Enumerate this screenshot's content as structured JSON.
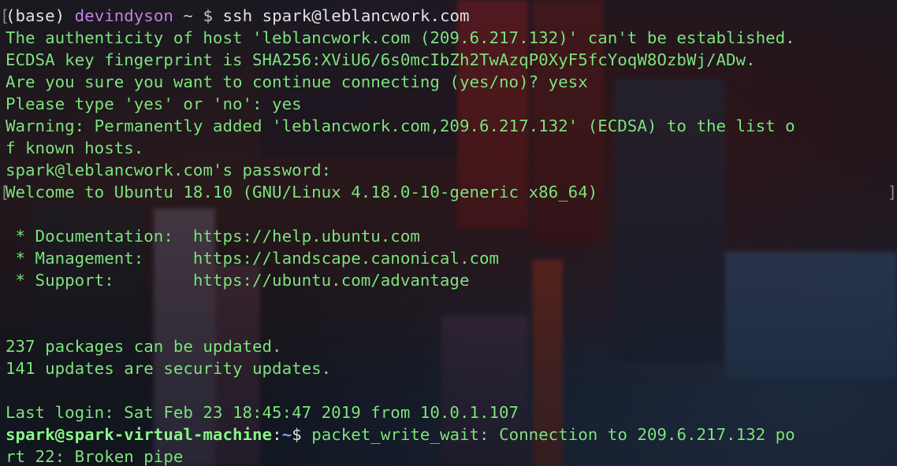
{
  "terminal": {
    "prompt": {
      "env": "(base)",
      "user": "devindyson",
      "path_symbol": "~",
      "dollar": "$",
      "command": "ssh spark@leblancwork.com"
    },
    "lines": [
      "The authenticity of host 'leblancwork.com (209.6.217.132)' can't be established.",
      "ECDSA key fingerprint is SHA256:XViU6/6s0mcIbZh2TwAzqP0XyF5fcYoqW8OzbWj/ADw.",
      "Are you sure you want to continue connecting (yes/no)? yesx",
      "Please type 'yes' or 'no': yes",
      "Warning: Permanently added 'leblancwork.com,209.6.217.132' (ECDSA) to the list o",
      "f known hosts.",
      "spark@leblancwork.com's password:",
      "Welcome to Ubuntu 18.10 (GNU/Linux 4.18.0-10-generic x86_64)",
      "",
      " * Documentation:  https://help.ubuntu.com",
      " * Management:     https://landscape.canonical.com",
      " * Support:        https://ubuntu.com/advantage",
      "",
      "",
      "237 packages can be updated.",
      "141 updates are security updates.",
      "",
      "Last login: Sat Feb 23 18:45:47 2019 from 10.0.1.107"
    ],
    "remote_prompt": {
      "user_host": "spark@spark-virtual-machine",
      "colon": ":",
      "path": "~",
      "dollar": "$",
      "output": "packet_write_wait: Connection to 209.6.217.132 po"
    },
    "last_line": "rt 22: Broken pipe",
    "colors": {
      "text": "#7fe37f",
      "user": "#c680e6",
      "path": "#7aa6f0"
    }
  }
}
